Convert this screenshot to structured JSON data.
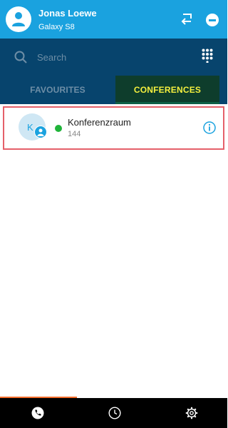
{
  "header": {
    "user_name": "Jonas Loewe",
    "device": "Galaxy S8",
    "avatar_icon": "person-icon",
    "actions": [
      "transfer-icon",
      "do-not-disturb-icon"
    ]
  },
  "search": {
    "placeholder": "Search",
    "dialpad_icon": "dialpad-icon"
  },
  "tabs": [
    {
      "label": "FAVOURITES",
      "active": false
    },
    {
      "label": "CONFERENCES",
      "active": true
    }
  ],
  "conferences": [
    {
      "initial": "K",
      "name": "Konferenzraum",
      "number": "144",
      "status": "online",
      "status_color": "#20b43a",
      "info_icon": "info-icon"
    }
  ],
  "bottom_nav": [
    {
      "icon": "phone-icon",
      "active": true
    },
    {
      "icon": "clock-icon",
      "active": false
    },
    {
      "icon": "gear-icon",
      "active": false
    }
  ],
  "colors": {
    "header": "#1aa2df",
    "nav_dark": "#07446d",
    "active_tab_text": "#f5f03e",
    "highlight_border": "#e5606a",
    "progress": "#f26b2a"
  }
}
